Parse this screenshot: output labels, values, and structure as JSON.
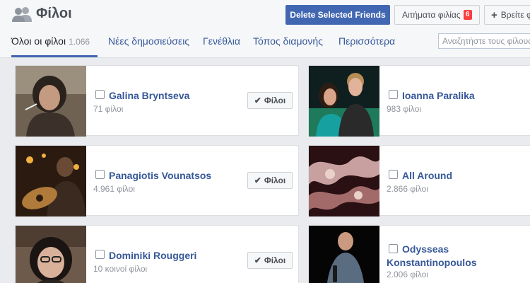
{
  "header": {
    "title": "Φίλοι",
    "delete_button": "Delete Selected Friends",
    "requests_button": "Αιτήματα φιλίας",
    "requests_count": "6",
    "find_button": "Βρείτε φίλους"
  },
  "tabs": [
    {
      "label": "Όλοι οι φίλοι",
      "count": "1.066"
    },
    {
      "label": "Νέες δημοσιεύσεις"
    },
    {
      "label": "Γενέθλια"
    },
    {
      "label": "Τόπος διαμονής"
    },
    {
      "label": "Περισσότερα"
    }
  ],
  "search": {
    "placeholder": "Αναζητήστε τους φίλους σας"
  },
  "friend_button_label": "Φίλοι",
  "friends": [
    {
      "name": "Galina Bryntseva",
      "meta": "71 φίλοι"
    },
    {
      "name": "Ioanna Paralika",
      "meta": "983 φίλοι"
    },
    {
      "name": "Panagiotis Vounatsos",
      "meta": "4.961 φίλοι"
    },
    {
      "name": "All Around",
      "meta": "2.866 φίλοι"
    },
    {
      "name": "Dominiki Rouggeri",
      "meta": "10 κοινοί φίλοι"
    },
    {
      "name": "Odysseas",
      "name2": "Konstantinopoulos",
      "meta": "2.006 φίλοι"
    }
  ],
  "colors": {
    "accent": "#4267b2",
    "link": "#365899",
    "badge": "#fa3e3e"
  }
}
